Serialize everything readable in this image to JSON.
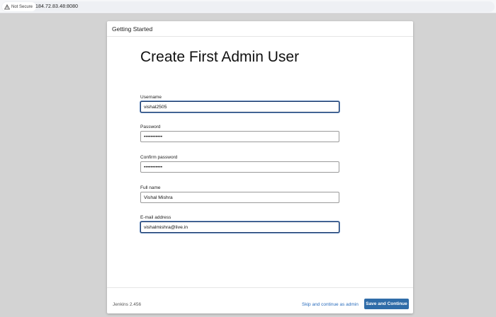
{
  "browser": {
    "security_label": "Not Secure",
    "url": "184.72.83.48:8080",
    "icon": "warning-triangle-icon"
  },
  "dialog": {
    "title": "Getting Started",
    "heading": "Create First Admin User",
    "fields": [
      {
        "label": "Username",
        "value": "vishal2505",
        "type": "text"
      },
      {
        "label": "Password",
        "value": "•••••••••••",
        "type": "password"
      },
      {
        "label": "Confirm password",
        "value": "•••••••••••",
        "type": "password"
      },
      {
        "label": "Full name",
        "value": "Vishal Mishra",
        "type": "text"
      },
      {
        "label": "E-mail address",
        "value": "vishalmishra@live.in",
        "type": "text"
      }
    ],
    "footer": {
      "version": "Jenkins 2.456",
      "skip_label": "Skip and continue as admin",
      "save_label": "Save and Continue"
    }
  },
  "colors": {
    "accent": "#2f6ca8",
    "link": "#2a6dbd",
    "page_background": "#d3d3d3",
    "focus_border": "#1b3a6a"
  }
}
